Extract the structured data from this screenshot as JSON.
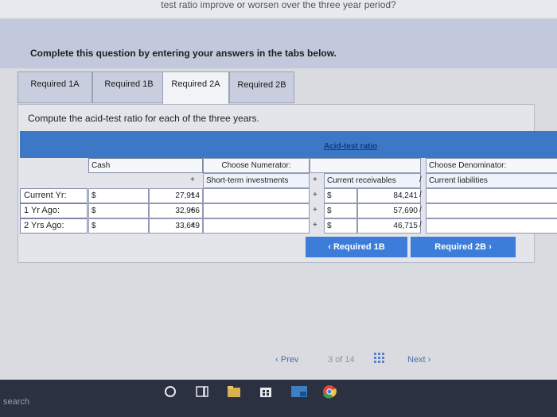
{
  "page": {
    "top_strip_text": "test ratio improve or worsen over the three year period?",
    "instruction": "Complete this question by entering your answers in the tabs below."
  },
  "tabs": [
    {
      "label": "Required 1A",
      "active": false
    },
    {
      "label": "Required 1B",
      "active": false
    },
    {
      "label": "Required 2A",
      "active": true
    },
    {
      "label": "Required 2B",
      "active": false
    }
  ],
  "panel": {
    "prompt": "Compute the acid-test ratio for each of the three years.",
    "header_title": "Acid-test ratio",
    "numerator_header": "Choose Numerator:",
    "denominator_header": "Choose Denominator:",
    "col_cash": "Cash",
    "col_short_term": "Short-term investments",
    "col_receivables": "Current receivables",
    "col_liabilities": "Current liabilities",
    "plus": "+",
    "slash": "/",
    "dollar": "$",
    "rows": [
      {
        "label": "Current Yr:",
        "cash": "27,914",
        "receivables": "84,241"
      },
      {
        "label": "1 Yr Ago:",
        "cash": "32,966",
        "receivables": "57,690"
      },
      {
        "label": "2 Yrs Ago:",
        "cash": "33,649",
        "receivables": "46,715"
      }
    ]
  },
  "nav": {
    "prev_label": "Required 1B",
    "next_label": "Required 2B"
  },
  "pager": {
    "prev": "Prev",
    "current": "3",
    "of": "of 14",
    "next": "Next"
  },
  "taskbar": {
    "search_text": "search"
  }
}
